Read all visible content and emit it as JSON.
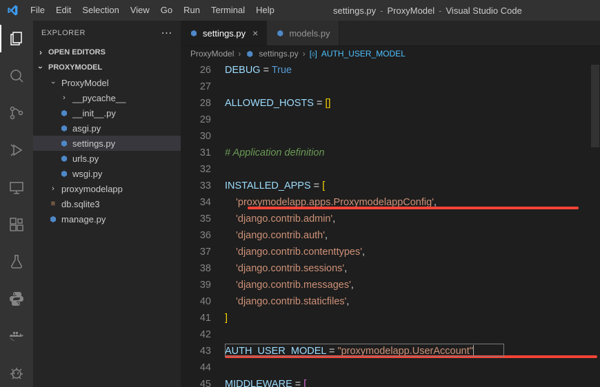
{
  "title": {
    "file": "settings.py",
    "project": "ProxyModel",
    "app": "Visual Studio Code"
  },
  "menu": [
    "File",
    "Edit",
    "Selection",
    "View",
    "Go",
    "Run",
    "Terminal",
    "Help"
  ],
  "sidebar": {
    "header": "EXPLORER",
    "sections": {
      "open_editors": "OPEN EDITORS",
      "project": "PROXYMODEL"
    },
    "tree": {
      "root": "ProxyModel",
      "pycache": "__pycache__",
      "init": "__init__.py",
      "asgi": "asgi.py",
      "settings": "settings.py",
      "urls": "urls.py",
      "wsgi": "wsgi.py",
      "app": "proxymodelapp",
      "db": "db.sqlite3",
      "manage": "manage.py"
    }
  },
  "tabs": {
    "settings": "settings.py",
    "models": "models.py"
  },
  "breadcrumbs": {
    "a": "ProxyModel",
    "b": "settings.py",
    "c": "AUTH_USER_MODEL"
  },
  "gutter": [
    "26",
    "27",
    "28",
    "29",
    "30",
    "31",
    "32",
    "33",
    "34",
    "35",
    "36",
    "37",
    "38",
    "39",
    "40",
    "41",
    "42",
    "43",
    "44",
    "45"
  ],
  "code": {
    "l26a": "DEBUG",
    "l26b": " = ",
    "l26c": "True",
    "l28a": "ALLOWED_HOSTS",
    "l28b": " = ",
    "l28c": "[]",
    "l31": "# Application definition",
    "l33a": "INSTALLED_APPS",
    "l33b": " = ",
    "l33c": "[",
    "l34": "    'proxymodelapp.apps.ProxymodelappConfig'",
    "l34b": ",",
    "l35": "    'django.contrib.admin'",
    "l35b": ",",
    "l36": "    'django.contrib.auth'",
    "l36b": ",",
    "l37": "    'django.contrib.contenttypes'",
    "l37b": ",",
    "l38": "    'django.contrib.sessions'",
    "l38b": ",",
    "l39": "    'django.contrib.messages'",
    "l39b": ",",
    "l40": "    'django.contrib.staticfiles'",
    "l40b": ",",
    "l41": "]",
    "l43a": "AUTH_USER_MODEL",
    "l43b": " = ",
    "l43c": "\"proxymodelapp.UserAccount\"",
    "l45a": "MIDDLEWARE",
    "l45b": " = ",
    "l45c": "["
  }
}
